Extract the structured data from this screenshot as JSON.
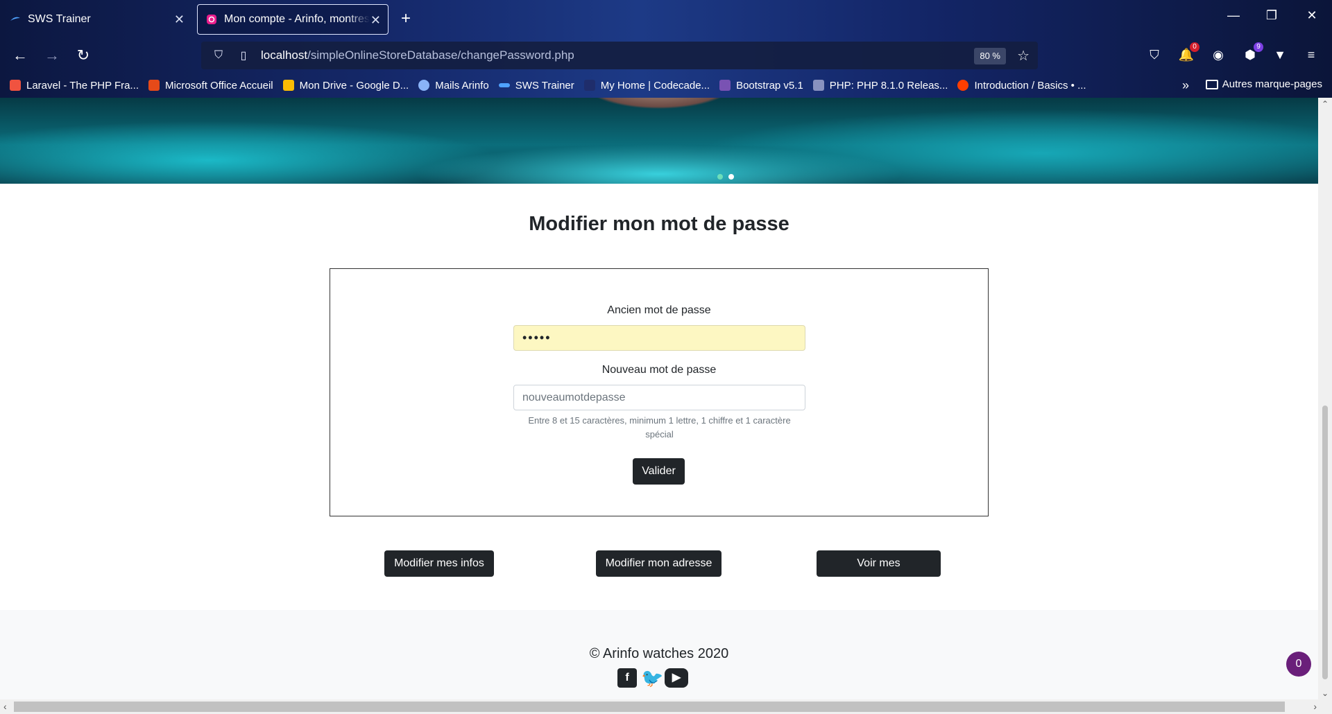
{
  "browser": {
    "tabs": [
      {
        "label": "SWS Trainer",
        "active": false
      },
      {
        "label": "Mon compte - Arinfo, montres d",
        "active": true
      }
    ],
    "url_host": "localhost",
    "url_path": "/simpleOnlineStoreDatabase/changePassword.php",
    "zoom": "80 %",
    "extension_badges": {
      "notifications": "0",
      "vpn": "9"
    },
    "bookmarks": [
      {
        "label": "Laravel - The PHP Fra...",
        "color": "#f05340"
      },
      {
        "label": "Microsoft Office Accueil",
        "color": "#e64a19"
      },
      {
        "label": "Mon Drive - Google D...",
        "color": "#fbbc04"
      },
      {
        "label": "Mails Arinfo",
        "color": "#8ab4f8"
      },
      {
        "label": "SWS Trainer",
        "color": "#4fa3ff"
      },
      {
        "label": "My Home | Codecade...",
        "color": "#1f2d6b"
      },
      {
        "label": "Bootstrap v5.1",
        "color": "#7952b3"
      },
      {
        "label": "PHP: PHP 8.1.0 Releas...",
        "color": "#8892bf"
      },
      {
        "label": "Introduction / Basics • ...",
        "color": "#ff3e00"
      }
    ],
    "other_bookmarks": "Autres marque-pages"
  },
  "page": {
    "title": "Modifier mon mot de passe",
    "old_password": {
      "label": "Ancien mot de passe",
      "value": "•••••"
    },
    "new_password": {
      "label": "Nouveau mot de passe",
      "placeholder": "nouveaumotdepasse",
      "help": "Entre 8 et 15 caractères, minimum 1 lettre, 1 chiffre et 1 caractère spécial"
    },
    "submit_label": "Valider",
    "actions": {
      "edit_info": "Modifier mes infos",
      "edit_address": "Modifier mon adresse",
      "orders": "Voir mes commandes"
    },
    "footer": {
      "copyright": "© Arinfo watches 2020"
    },
    "cart_count": "0"
  },
  "colors": {
    "button_dark": "#212529",
    "autofill": "#fdf7c2",
    "cart_bubble": "#6a1f7a"
  }
}
